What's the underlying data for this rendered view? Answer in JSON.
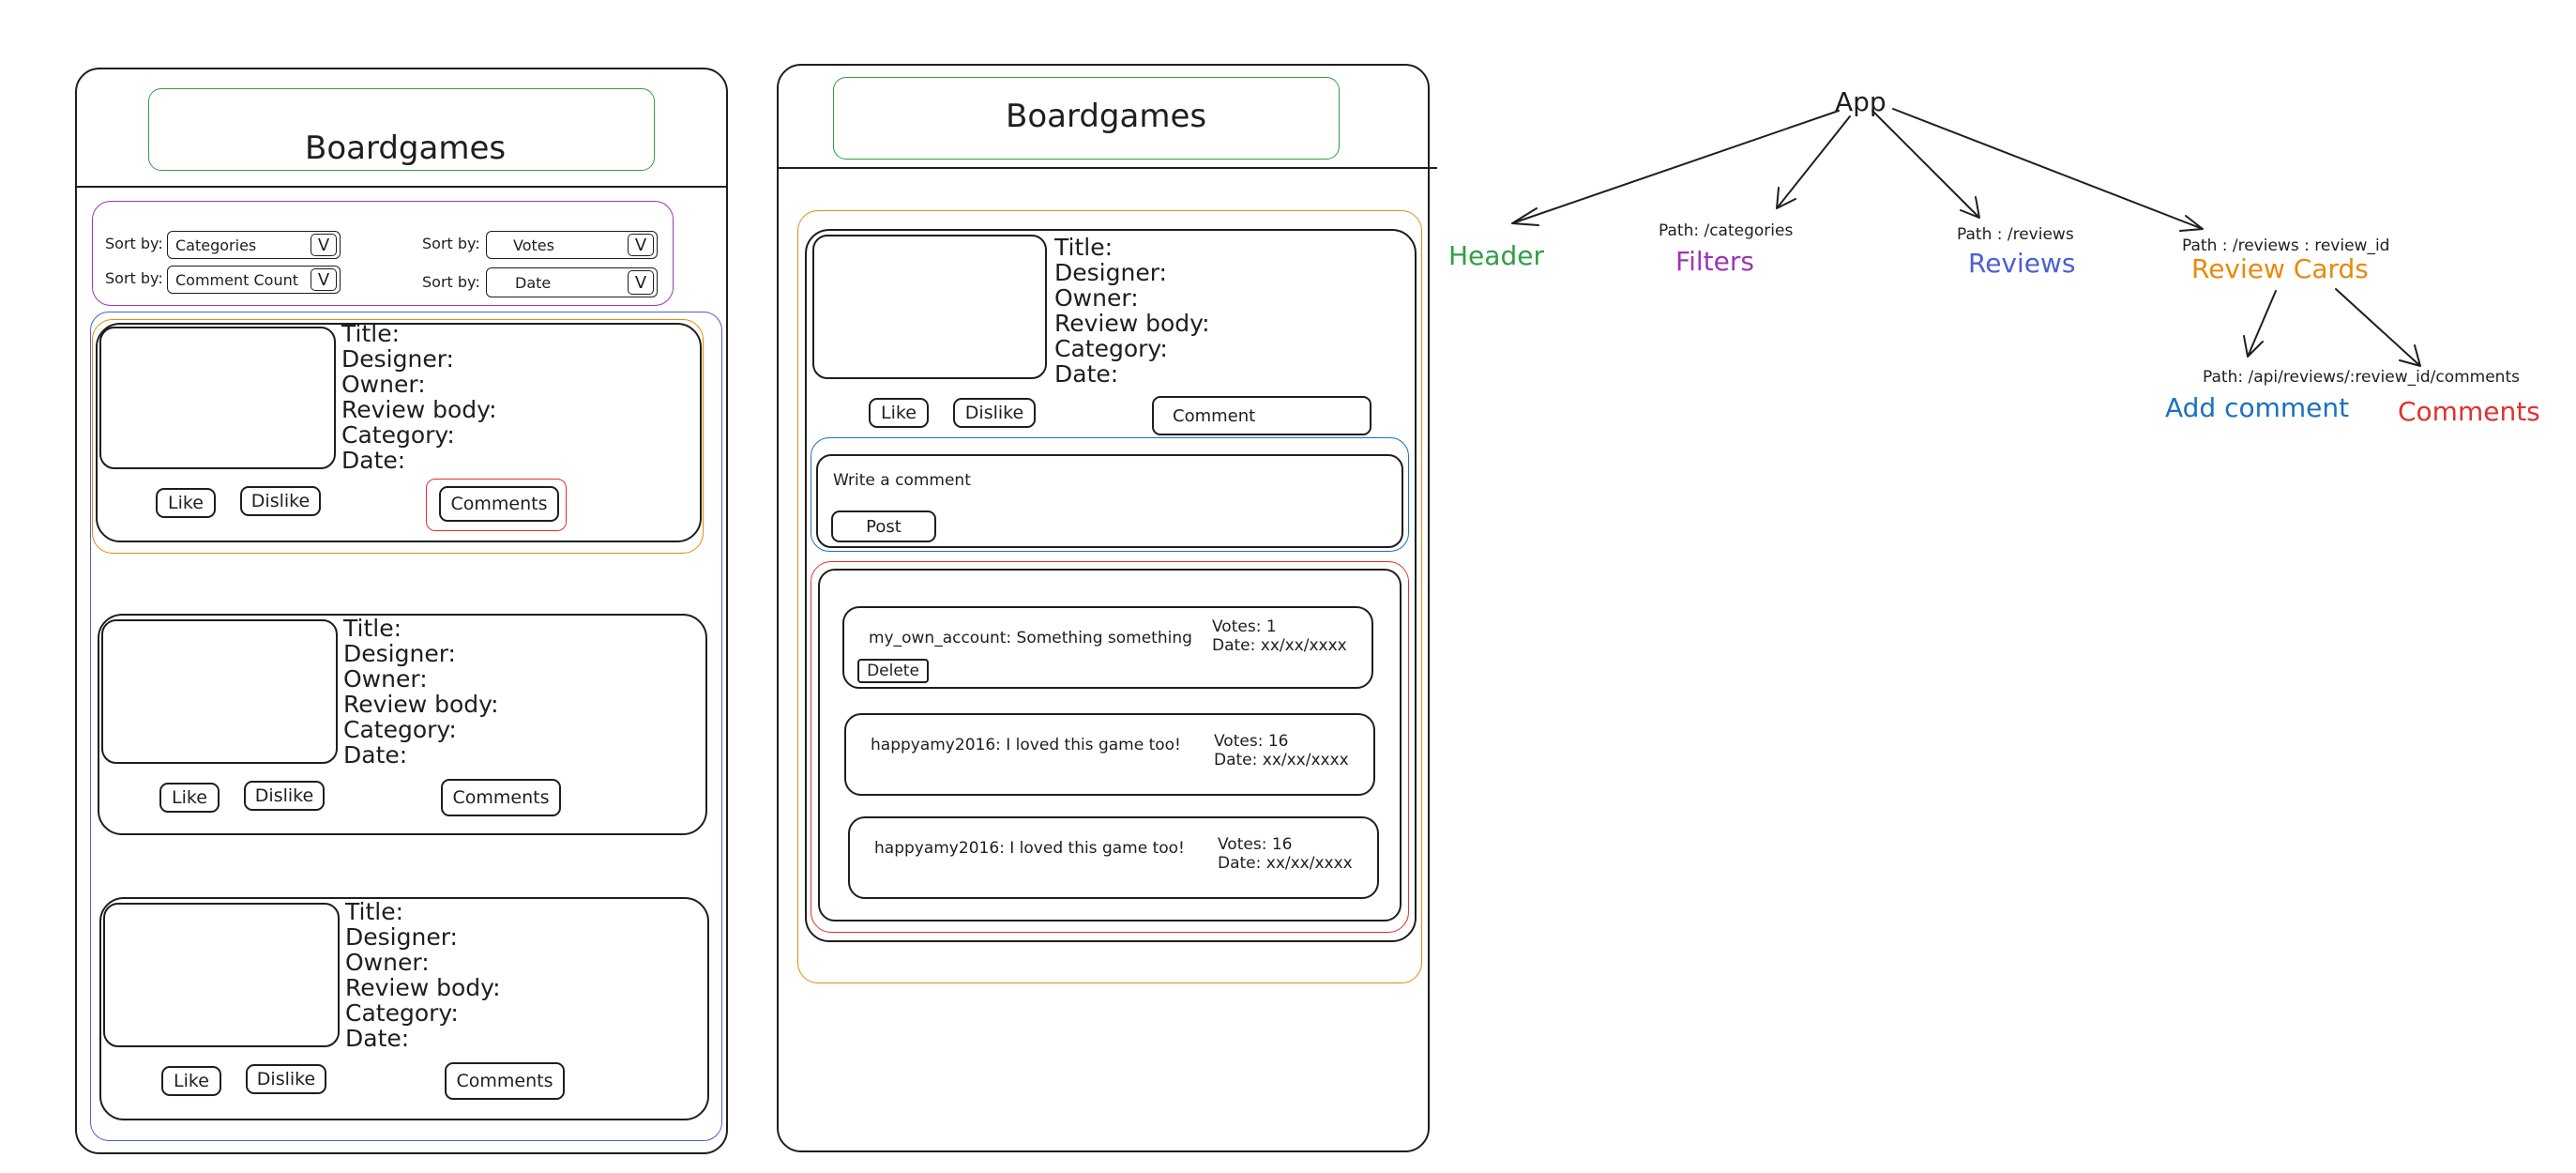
{
  "colors": {
    "header": "#2f9e44",
    "filters": "#9c36b5",
    "reviews": "#4c5fd5",
    "review_cards": "#e8890c",
    "add_comment": "#1971c2",
    "comments": "#e03131",
    "ink": "#1e1e1e"
  },
  "left_mockup": {
    "header_title": "Boardgames",
    "filters": [
      {
        "label": "Sort by:",
        "value": "Categories",
        "arrow": "V"
      },
      {
        "label": "Sort by:",
        "value": "Votes",
        "arrow": "V"
      },
      {
        "label": "Sort by:",
        "value": "Comment Count",
        "arrow": "V"
      },
      {
        "label": "Sort by:",
        "value": "Date",
        "arrow": "V"
      }
    ],
    "card_fields": [
      "Title:",
      "Designer:",
      "Owner:",
      "Review body:",
      "Category:",
      "Date:"
    ],
    "like": "Like",
    "dislike": "Dislike",
    "comments": "Comments"
  },
  "right_mockup": {
    "header_title": "Boardgames",
    "card_fields": [
      "Title:",
      "Designer:",
      "Owner:",
      "Review body:",
      "Category:",
      "Date:"
    ],
    "like": "Like",
    "dislike": "Dislike",
    "comment_button": "Comment",
    "write_comment_placeholder": "Write a comment",
    "post": "Post",
    "comments": [
      {
        "text": "my_own_account: Something something",
        "votes": "Votes: 1",
        "date": "Date: xx/xx/xxxx",
        "delete": "Delete"
      },
      {
        "text": "happyamy2016: I loved this game too!",
        "votes": "Votes: 16",
        "date": "Date: xx/xx/xxxx"
      },
      {
        "text": "happyamy2016: I loved this game too!",
        "votes": "Votes: 16",
        "date": "Date: xx/xx/xxxx"
      }
    ]
  },
  "tree": {
    "root": "App",
    "header": "Header",
    "filters_path": "Path: /categories",
    "filters": "Filters",
    "reviews_path": "Path : /reviews",
    "reviews": "Reviews",
    "review_cards_path": "Path : /reviews : review_id",
    "review_cards": "Review Cards",
    "add_comment_path": "Path: /api/reviews/:review_id/comments",
    "add_comment": "Add comment",
    "comments": "Comments"
  }
}
